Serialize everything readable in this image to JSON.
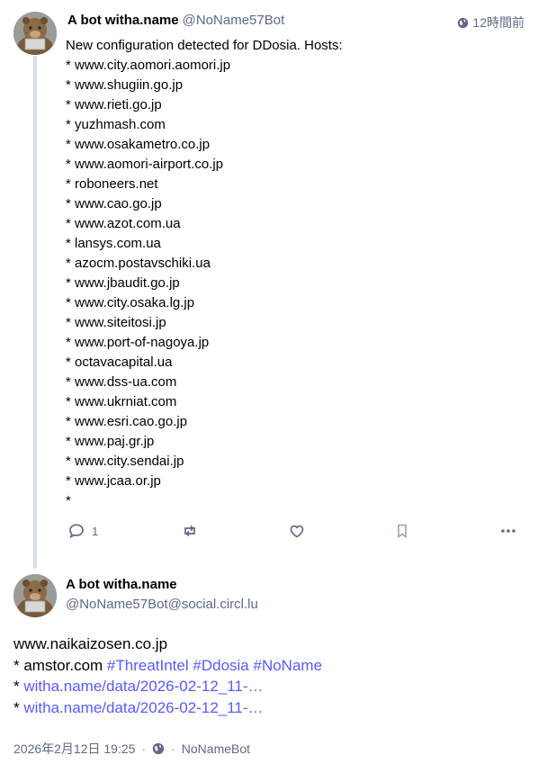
{
  "post1": {
    "display_name": "A bot witha.name",
    "handle": "@NoName57Bot",
    "time": "12時間前",
    "icon_visibility": "globe-icon",
    "lines": [
      "New configuration detected for DDosia. Hosts:",
      "* www.city.aomori.aomori.jp",
      "* www.shugiin.go.jp",
      "* www.rieti.go.jp",
      "* yuzhmash.com",
      "* www.osakametro.co.jp",
      "* www.aomori-airport.co.jp",
      "* roboneers.net",
      "* www.cao.go.jp",
      "* www.azot.com.ua",
      "* lansys.com.ua",
      "* azocm.postavschiki.ua",
      "* www.jbaudit.go.jp",
      "* www.city.osaka.lg.jp",
      "* www.siteitosi.jp",
      "* www.port-of-nagoya.jp",
      "* octavacapital.ua",
      "* www.dss-ua.com",
      "* www.ukrniat.com",
      "* www.esri.cao.go.jp",
      "* www.paj.gr.jp",
      "* www.city.sendai.jp",
      "* www.jcaa.or.jp",
      "*"
    ],
    "actions": {
      "reply_count": "1",
      "icons": [
        "reply-icon",
        "boost-icon",
        "favourite-icon",
        "bookmark-icon",
        "more-icon"
      ]
    }
  },
  "post2": {
    "display_name": "A bot witha.name",
    "handle": "@NoName57Bot@social.circl.lu",
    "line1": "www.naikaizosen.co.jp",
    "line2_prefix": "* amstor.com ",
    "hashtags": [
      "#ThreatIntel",
      "#Ddosia",
      "#NoName"
    ],
    "line3_prefix": "* ",
    "link1": "witha.name/data/2026-02-12_11-…",
    "line4_prefix": "* ",
    "link2": "witha.name/data/2026-02-12_11-…",
    "meta": {
      "date": "2026年2月12日 19:25",
      "separator": "·",
      "app": "NoNameBot"
    }
  },
  "colors": {
    "accent": "#595aff",
    "muted": "#606984",
    "thread_line": "#d9e1e8"
  }
}
